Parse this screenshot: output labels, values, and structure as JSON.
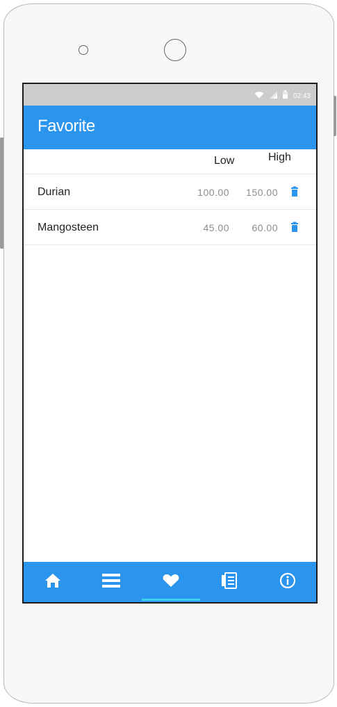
{
  "status_bar": {
    "time": "02:43",
    "icons": [
      "wifi-icon",
      "signal-icon",
      "battery-icon"
    ]
  },
  "app_bar": {
    "title": "Favorite"
  },
  "table": {
    "columns": {
      "low": "Low",
      "high": "High"
    },
    "rows": [
      {
        "name": "Durian",
        "low": "100.00",
        "high": "150.00"
      },
      {
        "name": "Mangosteen",
        "low": "45.00",
        "high": "60.00"
      }
    ]
  },
  "bottom_nav": {
    "items": [
      "home-icon",
      "menu-icon",
      "heart-icon",
      "list-icon",
      "info-icon"
    ],
    "active": "heart-icon"
  },
  "colors": {
    "accent": "#2b95ee",
    "active_indicator": "#3fd1ea",
    "status_bar": "#cccccc"
  }
}
